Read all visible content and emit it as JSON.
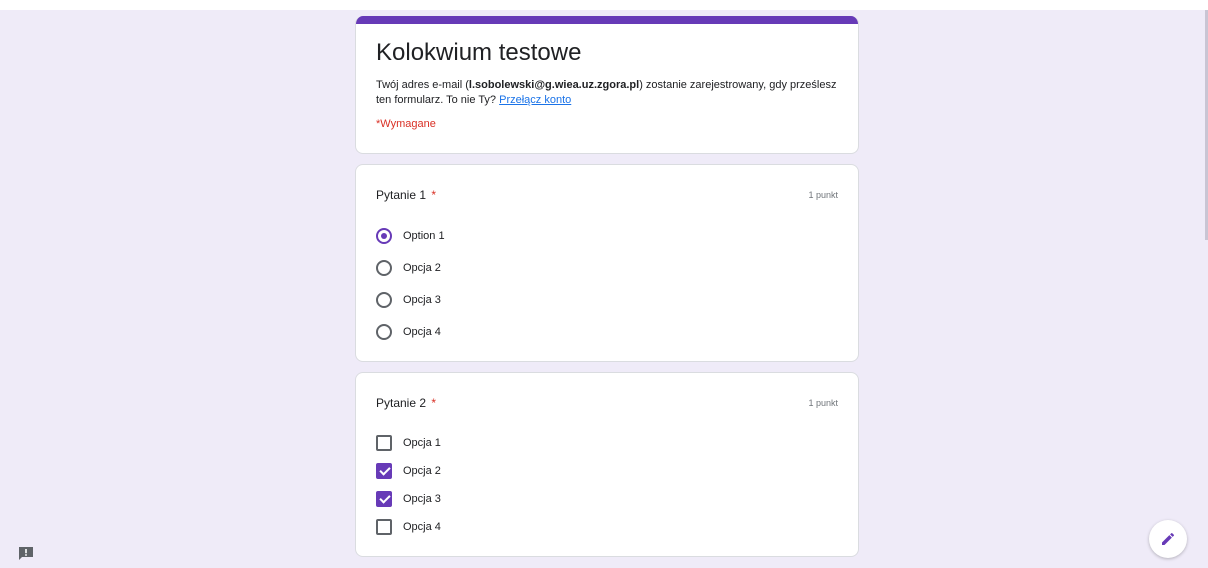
{
  "form": {
    "title": "Kolokwium testowe",
    "desc_before": "Twój adres e-mail (",
    "email": "l.sobolewski@g.wiea.uz.zgora.pl",
    "desc_after": ") zostanie zarejestrowany, gdy prześlesz ten formularz. To nie Ty? ",
    "switch_account": "Przełącz konto",
    "required_note": "*Wymagane",
    "accent_color": "#673ab7"
  },
  "questions": [
    {
      "title": "Pytanie 1",
      "required_mark": "*",
      "points": "1 punkt",
      "type": "radio",
      "options": [
        {
          "label": "Option 1",
          "checked": true
        },
        {
          "label": "Opcja 2",
          "checked": false
        },
        {
          "label": "Opcja 3",
          "checked": false
        },
        {
          "label": "Opcja 4",
          "checked": false
        }
      ]
    },
    {
      "title": "Pytanie 2",
      "required_mark": "*",
      "points": "1 punkt",
      "type": "checkbox",
      "options": [
        {
          "label": "Opcja 1",
          "checked": false
        },
        {
          "label": "Opcja 2",
          "checked": true
        },
        {
          "label": "Opcja 3",
          "checked": true
        },
        {
          "label": "Opcja 4",
          "checked": false
        }
      ]
    }
  ],
  "icons": {
    "edit": "pencil-icon",
    "feedback": "report-icon"
  }
}
